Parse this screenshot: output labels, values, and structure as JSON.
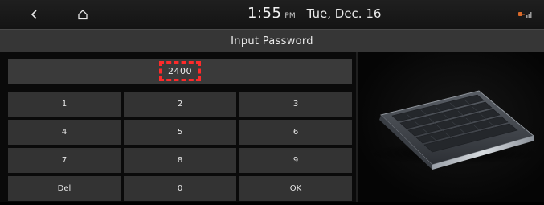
{
  "status_bar": {
    "back_icon": "chevron-left-icon",
    "home_icon": "home-icon",
    "time": "1:55",
    "ampm": "PM",
    "date": "Tue, Dec. 16",
    "status_icon": "connection-status-icon"
  },
  "header": {
    "title": "Input Password"
  },
  "password_field": {
    "value": "2400"
  },
  "keypad": {
    "keys": [
      "1",
      "2",
      "3",
      "4",
      "5",
      "6",
      "7",
      "8",
      "9",
      "Del",
      "0",
      "OK"
    ]
  },
  "illustration": {
    "icon": "keyboard-illustration"
  },
  "colors": {
    "highlight": "#ff2a2a",
    "key_background": "#333333",
    "title_background": "#363636"
  }
}
